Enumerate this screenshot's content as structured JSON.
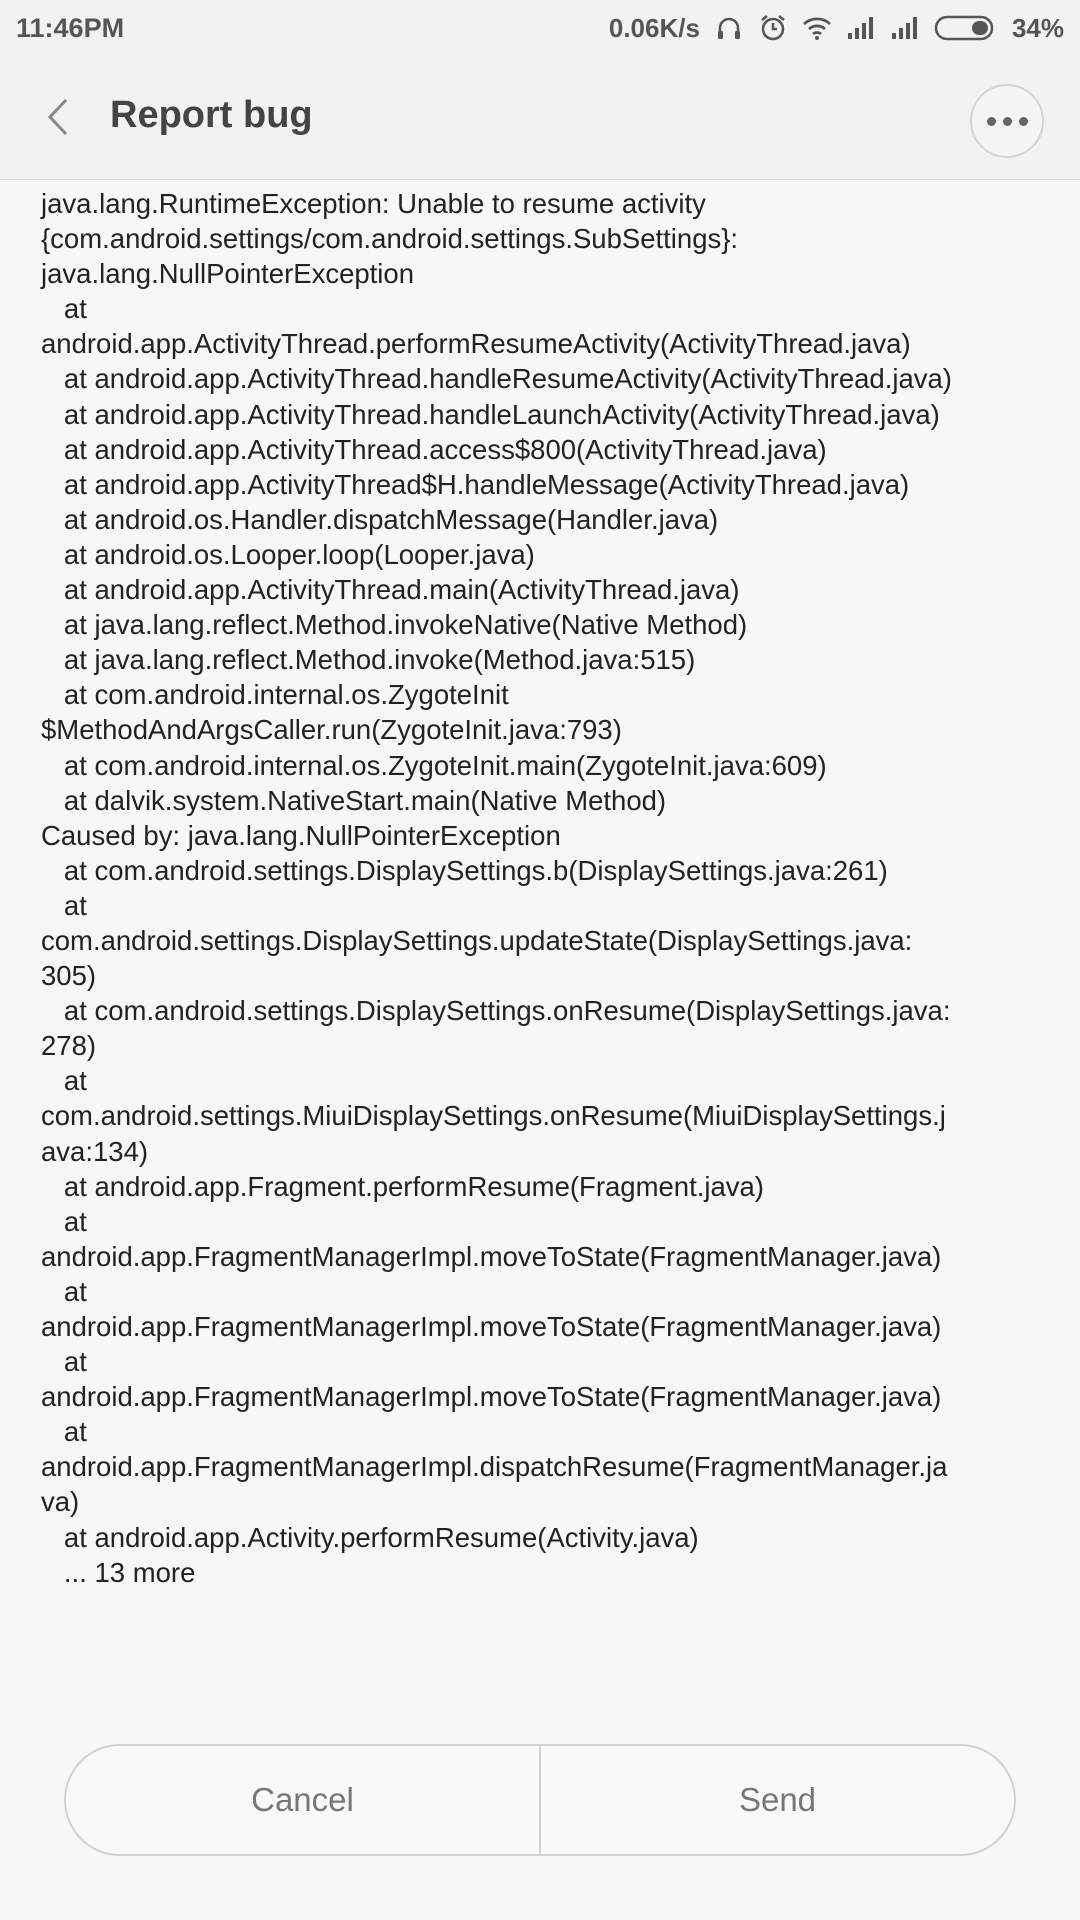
{
  "status_bar": {
    "time": "11:46PM",
    "net_speed": "0.06K/s",
    "battery_pct": "34%",
    "icons": [
      "headset-icon",
      "alarm-icon",
      "wifi-icon",
      "signal-icon",
      "signal-icon",
      "battery-icon"
    ]
  },
  "header": {
    "title": "Report bug",
    "back_icon": "chevron-left-icon",
    "more_icon": "more-horizontal-icon"
  },
  "log_lines": [
    "java.lang.RuntimeException: Unable to resume activity",
    "{com.android.settings/com.android.settings.SubSettings}:",
    "java.lang.NullPointerException",
    "   at",
    "android.app.ActivityThread.performResumeActivity(ActivityThread.java)",
    "   at android.app.ActivityThread.handleResumeActivity(ActivityThread.java)",
    "   at android.app.ActivityThread.handleLaunchActivity(ActivityThread.java)",
    "   at android.app.ActivityThread.access$800(ActivityThread.java)",
    "   at android.app.ActivityThread$H.handleMessage(ActivityThread.java)",
    "   at android.os.Handler.dispatchMessage(Handler.java)",
    "   at android.os.Looper.loop(Looper.java)",
    "   at android.app.ActivityThread.main(ActivityThread.java)",
    "   at java.lang.reflect.Method.invokeNative(Native Method)",
    "   at java.lang.reflect.Method.invoke(Method.java:515)",
    "   at com.android.internal.os.ZygoteInit",
    "$MethodAndArgsCaller.run(ZygoteInit.java:793)",
    "   at com.android.internal.os.ZygoteInit.main(ZygoteInit.java:609)",
    "   at dalvik.system.NativeStart.main(Native Method)",
    "Caused by: java.lang.NullPointerException",
    "   at com.android.settings.DisplaySettings.b(DisplaySettings.java:261)",
    "   at",
    "com.android.settings.DisplaySettings.updateState(DisplaySettings.java:",
    "305)",
    "   at com.android.settings.DisplaySettings.onResume(DisplaySettings.java:",
    "278)",
    "   at",
    "com.android.settings.MiuiDisplaySettings.onResume(MiuiDisplaySettings.j",
    "ava:134)",
    "   at android.app.Fragment.performResume(Fragment.java)",
    "   at",
    "android.app.FragmentManagerImpl.moveToState(FragmentManager.java)",
    "   at",
    "android.app.FragmentManagerImpl.moveToState(FragmentManager.java)",
    "   at",
    "android.app.FragmentManagerImpl.moveToState(FragmentManager.java)",
    "   at",
    "android.app.FragmentManagerImpl.dispatchResume(FragmentManager.ja",
    "va)",
    "   at android.app.Activity.performResume(Activity.java)",
    "   ... 13 more"
  ],
  "actions": {
    "cancel_label": "Cancel",
    "send_label": "Send"
  },
  "colors": {
    "background": "#f7f7f7",
    "bar": "#f2f2f2",
    "text": "#222222",
    "muted": "#777777"
  }
}
